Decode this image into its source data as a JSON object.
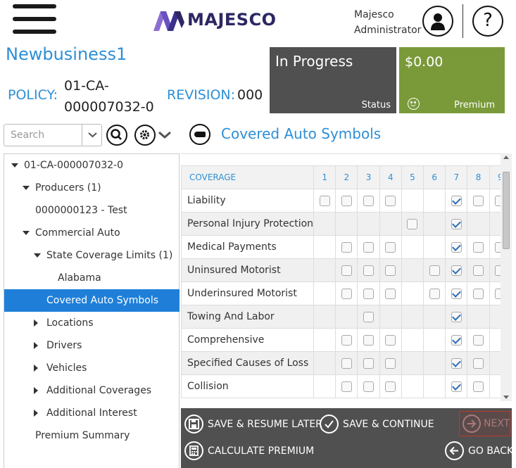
{
  "header": {
    "logo_text": "MAJESCO",
    "user_line1": "Majesco",
    "user_line2": "Administrator",
    "help_glyph": "?"
  },
  "policy": {
    "title": "Newbusiness1",
    "policy_label": "POLICY:",
    "policy_number_line1": "01-CA-",
    "policy_number_line2": "000007032-0",
    "revision_label": "REVISION:",
    "revision_value": "000"
  },
  "status_tile": {
    "value": "In Progress",
    "label": "Status"
  },
  "premium_tile": {
    "value": "$0.00",
    "label": "Premium"
  },
  "search": {
    "placeholder": "Search"
  },
  "section": {
    "title": "Covered Auto Symbols"
  },
  "tree": [
    {
      "label": "01-CA-000007032-0",
      "expander": "down",
      "selected": false
    },
    {
      "label": "Producers (1)",
      "expander": "down",
      "selected": false
    },
    {
      "label": "0000000123 - Test",
      "expander": "none",
      "selected": false
    },
    {
      "label": "Commercial Auto",
      "expander": "down",
      "selected": false
    },
    {
      "label": "State Coverage Limits (1)",
      "expander": "down",
      "selected": false
    },
    {
      "label": "Alabama",
      "expander": "none",
      "selected": false
    },
    {
      "label": "Covered Auto Symbols",
      "expander": "none",
      "selected": true
    },
    {
      "label": "Locations",
      "expander": "right",
      "selected": false
    },
    {
      "label": "Drivers",
      "expander": "right",
      "selected": false
    },
    {
      "label": "Vehicles",
      "expander": "right",
      "selected": false
    },
    {
      "label": "Additional Coverages",
      "expander": "right",
      "selected": false
    },
    {
      "label": "Additional Interest",
      "expander": "right",
      "selected": false
    },
    {
      "label": "Premium Summary",
      "expander": "none",
      "selected": false
    }
  ],
  "grid": {
    "coverage_header": "COVERAGE",
    "columns": [
      "1",
      "2",
      "3",
      "4",
      "5",
      "6",
      "7",
      "8",
      "9"
    ],
    "rows": [
      {
        "name": "Liability",
        "cells": [
          "off",
          "off",
          "off",
          "off",
          "",
          "",
          "on",
          "off",
          "off"
        ]
      },
      {
        "name": "Personal Injury Protection",
        "cells": [
          "",
          "",
          "",
          "",
          "off",
          "",
          "on",
          "",
          ""
        ]
      },
      {
        "name": "Medical Payments",
        "cells": [
          "",
          "off",
          "off",
          "off",
          "",
          "",
          "on",
          "off",
          "off"
        ]
      },
      {
        "name": "Uninsured Motorist",
        "cells": [
          "",
          "off",
          "off",
          "off",
          "",
          "off",
          "on",
          "off",
          "off"
        ]
      },
      {
        "name": "Underinsured Motorist",
        "cells": [
          "",
          "off",
          "off",
          "off",
          "",
          "off",
          "on",
          "off",
          "off"
        ]
      },
      {
        "name": "Towing And Labor",
        "cells": [
          "",
          "",
          "off",
          "",
          "",
          "",
          "on",
          "",
          ""
        ]
      },
      {
        "name": "Comprehensive",
        "cells": [
          "",
          "off",
          "off",
          "off",
          "",
          "",
          "on",
          "off",
          ""
        ]
      },
      {
        "name": "Specified Causes of Loss",
        "cells": [
          "",
          "off",
          "off",
          "off",
          "",
          "",
          "on",
          "off",
          ""
        ]
      },
      {
        "name": "Collision",
        "cells": [
          "",
          "off",
          "off",
          "off",
          "",
          "",
          "on",
          "off",
          ""
        ]
      }
    ]
  },
  "footer": {
    "save_resume": "SAVE & RESUME LATER",
    "save_continue": "SAVE & CONTINUE",
    "next": "NEXT",
    "calculate": "CALCULATE PREMIUM",
    "go_back": "GO BACK"
  },
  "colors": {
    "accent_blue": "#2d8fd5",
    "selected_blue": "#1f7fd8",
    "status_gray": "#505050",
    "premium_green": "#7a9a3a",
    "logo_navy": "#2c2763",
    "next_border_red": "#c0392b"
  }
}
